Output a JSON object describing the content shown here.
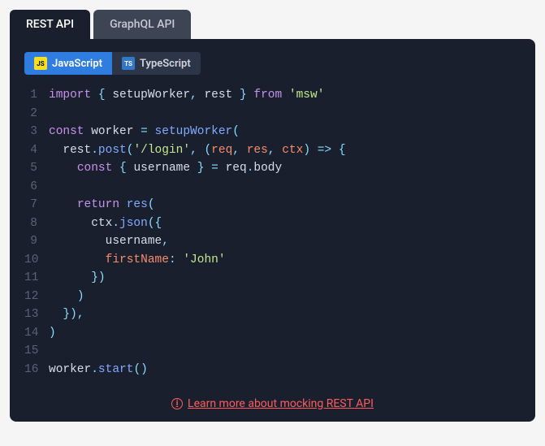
{
  "tabs": {
    "rest": "REST API",
    "graphql": "GraphQL API"
  },
  "langs": {
    "js": {
      "badge": "JS",
      "label": "JavaScript"
    },
    "ts": {
      "badge": "TS",
      "label": "TypeScript"
    }
  },
  "code": {
    "lines": [
      {
        "n": "1",
        "tokens": [
          [
            "k",
            "import"
          ],
          [
            "p",
            " "
          ],
          [
            "op",
            "{"
          ],
          [
            "p",
            " "
          ],
          [
            "v",
            "setupWorker"
          ],
          [
            "op",
            ","
          ],
          [
            "p",
            " "
          ],
          [
            "v",
            "rest"
          ],
          [
            "p",
            " "
          ],
          [
            "op",
            "}"
          ],
          [
            "p",
            " "
          ],
          [
            "k",
            "from"
          ],
          [
            "p",
            " "
          ],
          [
            "s",
            "'msw'"
          ]
        ]
      },
      {
        "n": "2",
        "tokens": []
      },
      {
        "n": "3",
        "tokens": [
          [
            "k",
            "const"
          ],
          [
            "p",
            " "
          ],
          [
            "v",
            "worker"
          ],
          [
            "p",
            " "
          ],
          [
            "op",
            "="
          ],
          [
            "p",
            " "
          ],
          [
            "fn",
            "setupWorker"
          ],
          [
            "op",
            "("
          ]
        ]
      },
      {
        "n": "4",
        "tokens": [
          [
            "p",
            "  "
          ],
          [
            "v",
            "rest"
          ],
          [
            "op",
            "."
          ],
          [
            "fn",
            "post"
          ],
          [
            "op",
            "("
          ],
          [
            "s",
            "'/login'"
          ],
          [
            "op",
            ","
          ],
          [
            "p",
            " "
          ],
          [
            "op",
            "("
          ],
          [
            "pr",
            "req"
          ],
          [
            "op",
            ","
          ],
          [
            "p",
            " "
          ],
          [
            "pr",
            "res"
          ],
          [
            "op",
            ","
          ],
          [
            "p",
            " "
          ],
          [
            "pr",
            "ctx"
          ],
          [
            "op",
            ")"
          ],
          [
            "p",
            " "
          ],
          [
            "op",
            "=>"
          ],
          [
            "p",
            " "
          ],
          [
            "op",
            "{"
          ]
        ]
      },
      {
        "n": "5",
        "tokens": [
          [
            "p",
            "    "
          ],
          [
            "k",
            "const"
          ],
          [
            "p",
            " "
          ],
          [
            "op",
            "{"
          ],
          [
            "p",
            " "
          ],
          [
            "v",
            "username"
          ],
          [
            "p",
            " "
          ],
          [
            "op",
            "}"
          ],
          [
            "p",
            " "
          ],
          [
            "op",
            "="
          ],
          [
            "p",
            " "
          ],
          [
            "v",
            "req"
          ],
          [
            "op",
            "."
          ],
          [
            "v",
            "body"
          ]
        ]
      },
      {
        "n": "6",
        "tokens": []
      },
      {
        "n": "7",
        "tokens": [
          [
            "p",
            "    "
          ],
          [
            "k",
            "return"
          ],
          [
            "p",
            " "
          ],
          [
            "fn",
            "res"
          ],
          [
            "op",
            "("
          ]
        ]
      },
      {
        "n": "8",
        "tokens": [
          [
            "p",
            "      "
          ],
          [
            "v",
            "ctx"
          ],
          [
            "op",
            "."
          ],
          [
            "fn",
            "json"
          ],
          [
            "op",
            "("
          ],
          [
            "op",
            "{"
          ]
        ]
      },
      {
        "n": "9",
        "tokens": [
          [
            "p",
            "        "
          ],
          [
            "v",
            "username"
          ],
          [
            "op",
            ","
          ]
        ]
      },
      {
        "n": "10",
        "tokens": [
          [
            "p",
            "        "
          ],
          [
            "pr",
            "firstName"
          ],
          [
            "op",
            ":"
          ],
          [
            "p",
            " "
          ],
          [
            "s",
            "'John'"
          ]
        ]
      },
      {
        "n": "11",
        "tokens": [
          [
            "p",
            "      "
          ],
          [
            "op",
            "}"
          ],
          [
            "op",
            ")"
          ]
        ]
      },
      {
        "n": "12",
        "tokens": [
          [
            "p",
            "    "
          ],
          [
            "op",
            ")"
          ]
        ]
      },
      {
        "n": "13",
        "tokens": [
          [
            "p",
            "  "
          ],
          [
            "op",
            "}"
          ],
          [
            "op",
            ")"
          ],
          [
            "op",
            ","
          ]
        ]
      },
      {
        "n": "14",
        "tokens": [
          [
            "op",
            ")"
          ]
        ]
      },
      {
        "n": "15",
        "tokens": []
      },
      {
        "n": "16",
        "tokens": [
          [
            "v",
            "worker"
          ],
          [
            "op",
            "."
          ],
          [
            "fn",
            "start"
          ],
          [
            "op",
            "("
          ],
          [
            "op",
            ")"
          ]
        ]
      }
    ]
  },
  "footer": {
    "link_text": "Learn more about mocking REST API"
  }
}
